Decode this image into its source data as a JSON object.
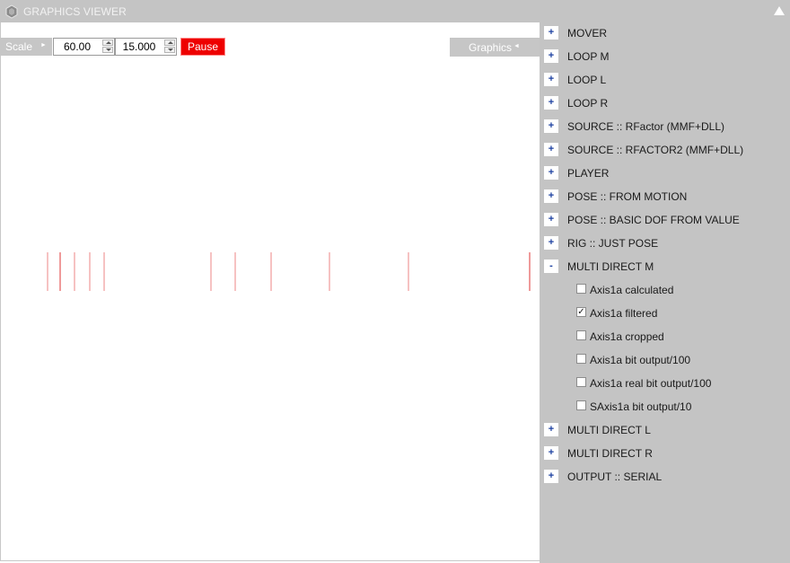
{
  "window": {
    "title": "GRAPHICS VIEWER",
    "collapse_icon": "triangle-up-icon"
  },
  "toolbar": {
    "scale_label": "Scale",
    "scale_value": "60.00",
    "window_value": "15.000",
    "pause_label": "Pause",
    "graphics_label": "Graphics"
  },
  "colors": {
    "panel": "#c4c4c4",
    "pause": "#ee0000",
    "trace": "#ef9a9a",
    "expander_sign": "#1b3fa0"
  },
  "panel": {
    "groups_before": [
      {
        "sign": "+",
        "label": "MOVER"
      },
      {
        "sign": "+",
        "label": "LOOP M"
      },
      {
        "sign": "+",
        "label": "LOOP L"
      },
      {
        "sign": "+",
        "label": "LOOP R"
      },
      {
        "sign": "+",
        "label": "SOURCE :: RFactor (MMF+DLL)"
      },
      {
        "sign": "+",
        "label": "SOURCE :: RFACTOR2 (MMF+DLL)"
      },
      {
        "sign": "+",
        "label": "PLAYER"
      },
      {
        "sign": "+",
        "label": "POSE :: FROM MOTION"
      },
      {
        "sign": "+",
        "label": "POSE :: BASIC DOF FROM VALUE"
      },
      {
        "sign": "+",
        "label": "RIG :: JUST POSE"
      }
    ],
    "expanded_group": {
      "sign": "-",
      "label": "MULTI DIRECT M"
    },
    "channels": [
      {
        "label": "Axis1a calculated",
        "checked": false
      },
      {
        "label": "Axis1a filtered",
        "checked": true
      },
      {
        "label": "Axis1a cropped",
        "checked": false
      },
      {
        "label": "Axis1a bit output/100",
        "checked": false
      },
      {
        "label": "Axis1a real bit output/100",
        "checked": false
      },
      {
        "label": "SAxis1a bit output/10",
        "checked": false
      }
    ],
    "groups_after": [
      {
        "sign": "+",
        "label": "MULTI DIRECT L"
      },
      {
        "sign": "+",
        "label": "MULTI DIRECT R"
      },
      {
        "sign": "+",
        "label": "OUTPUT :: SERIAL"
      }
    ]
  }
}
